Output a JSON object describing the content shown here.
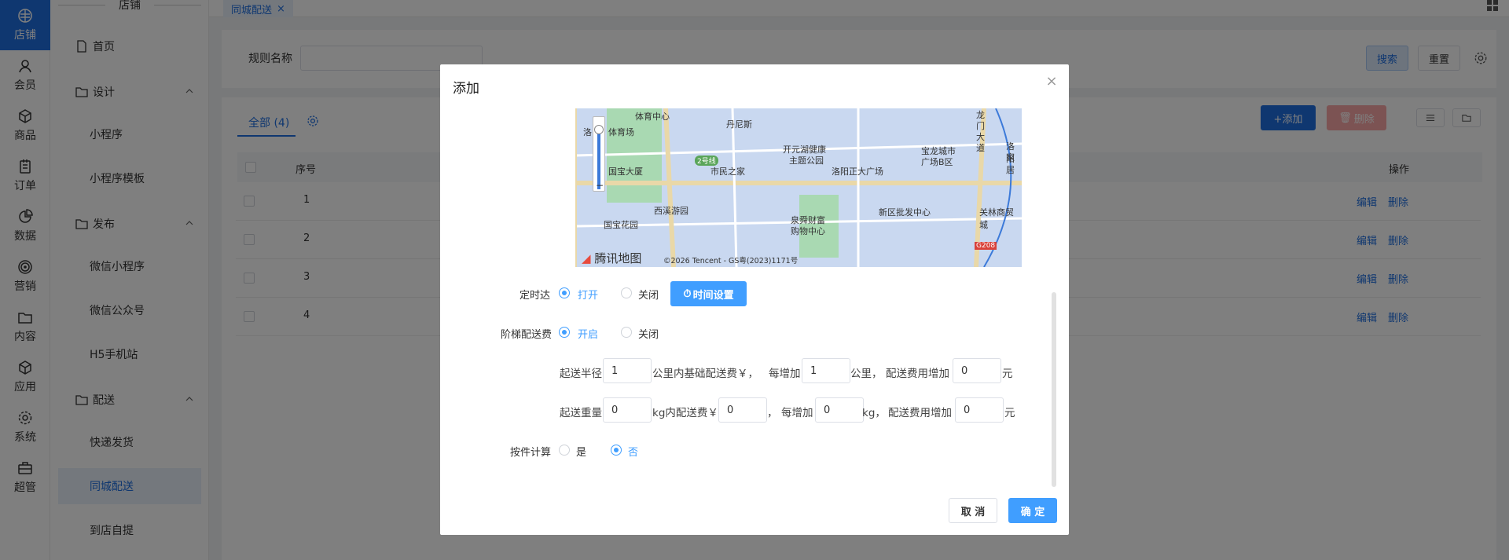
{
  "rail": {
    "items": [
      {
        "label": "店铺",
        "icon": "store-icon"
      },
      {
        "label": "会员",
        "icon": "member-icon"
      },
      {
        "label": "商品",
        "icon": "product-icon"
      },
      {
        "label": "订单",
        "icon": "order-icon"
      },
      {
        "label": "数据",
        "icon": "data-icon"
      },
      {
        "label": "营销",
        "icon": "marketing-icon"
      },
      {
        "label": "内容",
        "icon": "content-icon"
      },
      {
        "label": "应用",
        "icon": "app-icon"
      },
      {
        "label": "系统",
        "icon": "gear-icon"
      },
      {
        "label": "超管",
        "icon": "admin-icon"
      }
    ]
  },
  "sidebar": {
    "title": "店铺",
    "home": "首页",
    "design": "设计",
    "miniprogram": "小程序",
    "miniprogram_template": "小程序模板",
    "publish": "发布",
    "wechat_mini": "微信小程序",
    "wechat_official": "微信公众号",
    "h5": "H5手机站",
    "delivery": "配送",
    "express": "快递发货",
    "city_delivery": "同城配送",
    "pickup": "到店自提"
  },
  "tabbar": {
    "active_tab": "同城配送",
    "close": "×"
  },
  "search": {
    "rule_name_label": "规则名称",
    "rule_name_value": "",
    "search_btn": "搜索",
    "reset_btn": "重置"
  },
  "list": {
    "tab_all": "全部 (4)",
    "add_btn": "+添加",
    "delete_btn": "删除",
    "col_index": "序号",
    "col_ops": "操作",
    "rows": [
      {
        "index": "1",
        "edit": "编辑",
        "delete": "删除"
      },
      {
        "index": "2",
        "edit": "编辑",
        "delete": "删除"
      },
      {
        "index": "3",
        "edit": "编辑",
        "delete": "删除"
      },
      {
        "index": "4",
        "edit": "编辑",
        "delete": "删除"
      }
    ]
  },
  "dialog": {
    "title": "添加",
    "close": "×",
    "map": {
      "labels": [
        "体育中心",
        "丹尼斯",
        "洛",
        "体育场",
        "开元湖健康",
        "主题公园",
        "宝龙城市",
        "广场B区",
        "龙",
        "门",
        "大",
        "道",
        "洛阳",
        "家居",
        "2号线",
        "市民之家",
        "国宝大厦",
        "洛阳正大广场",
        "西溪游园",
        "泉舜财富",
        "购物中心",
        "新区批发中心",
        "国宝花园",
        "关林商贸城",
        "G208"
      ],
      "brand": "腾讯地图",
      "copyright": "©2026 Tencent - GS粤(2023)1171号",
      "zoom_out": "−"
    },
    "timed": {
      "label": "定时达",
      "on": "打开",
      "off": "关闭",
      "selected": "打开",
      "time_btn": "时间设置"
    },
    "tiered": {
      "label": "阶梯配送费",
      "on": "开启",
      "off": "关闭",
      "selected": "开启"
    },
    "distance": {
      "t1": "起送半径",
      "v1": "1",
      "t2": "公里内基础配送费￥，",
      "t3": "每增加",
      "v2": "1",
      "t4": "公里，",
      "t5": "配送费用增加",
      "v3": "0",
      "t6": "元"
    },
    "weight": {
      "t1": "起送重量",
      "v1": "0",
      "t2": "kg内配送费￥",
      "v2": "0",
      "t3": "，",
      "t4": "每增加",
      "v3": "0",
      "t5": "kg，",
      "t6": "配送费用增加",
      "v4": "0",
      "t7": "元"
    },
    "piece": {
      "label": "按件计算",
      "yes": "是",
      "no": "否",
      "selected": "否"
    },
    "cancel": "取 消",
    "confirm": "确 定"
  }
}
